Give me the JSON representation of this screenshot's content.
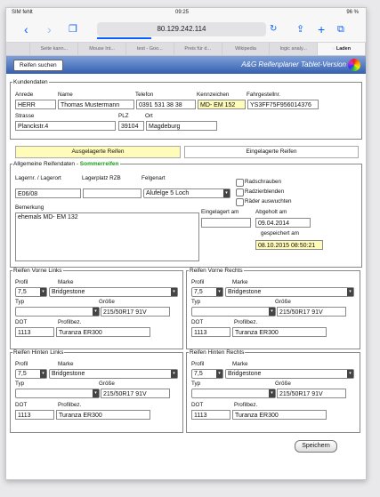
{
  "status": {
    "carrier": "SIM fehlt",
    "time": "09:25",
    "battery": "96 %"
  },
  "browser": {
    "url": "80.129.242.114",
    "load_fraction": 0.32
  },
  "tabs": [
    "",
    "Seite kann...",
    "Mouse Int...",
    "test - Goo...",
    "Preis für d...",
    "Wikipedia",
    "logic analy...",
    "Laden"
  ],
  "app": {
    "search_button": "Reifen suchen",
    "title": "A&G Reifenplaner Tablet-Version"
  },
  "kunde": {
    "legend": "Kundendaten",
    "labels": {
      "anrede": "Anrede",
      "name": "Name",
      "telefon": "Telefon",
      "kennzeichen": "Kennzeichen",
      "fahrgestell": "Fahrgestellnr.",
      "strasse": "Strasse",
      "plz": "PLZ",
      "ort": "Ort"
    },
    "anrede": "HERR",
    "name": "Thomas Mustermann",
    "telefon": "0391 531 38 38",
    "kennzeichen": "MD- EM 152",
    "fahrgestell": "YS3FF75F956014376",
    "strasse": "Planckstr.4",
    "plz": "39104",
    "ort": "Magdeburg"
  },
  "sections": {
    "ausgelagert": "Ausgelagerte Reifen",
    "eingelagert": "Eingelagerte Reifen"
  },
  "allgemein": {
    "legend_prefix": "Allgemeine Reifendaten - ",
    "legend_season": "Sommerreifen",
    "labels": {
      "lagerort": "Lagernr. / Lagerort",
      "lagerplatz": "Lagerplatz RZB",
      "felgenart": "Felgenart",
      "bemerkung": "Bemerkung",
      "eingelagert": "Eingelagert am",
      "abgeholt": "Abgeholt am",
      "gespeichert": "gespeichert am"
    },
    "lagerort": "E06/08",
    "lagerplatz": "",
    "felgenart": "Alufelge 5 Loch",
    "checkboxes": [
      "Radschrauben",
      "Radzierblenden",
      "Räder auswuchten"
    ],
    "bemerkung": "ehemals MD- EM 132",
    "eingelagert": "",
    "abgeholt": "09.04.2014",
    "gespeichert": "08.10.2015 08:50:21"
  },
  "labels": {
    "profil": "Profil",
    "marke": "Marke",
    "typ": "Typ",
    "groesse": "Größe",
    "dot": "DOT",
    "profilbez": "Profilbez."
  },
  "tires": [
    {
      "legend": "Reifen Vorne Links",
      "profil": "7,5",
      "marke": "Bridgestone",
      "typ": "",
      "groesse": "215/50R17 91V",
      "dot": "1113",
      "profilbez": "Turanza ER300"
    },
    {
      "legend": "Reifen Vorne Rechts",
      "profil": "7,5",
      "marke": "Bridgestone",
      "typ": "",
      "groesse": "215/50R17 91V",
      "dot": "1113",
      "profilbez": "Turanza ER300"
    },
    {
      "legend": "Reifen Hinten Links",
      "profil": "7,5",
      "marke": "Bridgestone",
      "typ": "",
      "groesse": "215/50R17 91V",
      "dot": "1113",
      "profilbez": "Turanza ER300"
    },
    {
      "legend": "Reifen Hinten Rechts",
      "profil": "7,5",
      "marke": "Bridgestone",
      "typ": "",
      "groesse": "215/50R17 91V",
      "dot": "1113",
      "profilbez": "Turanza ER300"
    }
  ],
  "save_button": "Speichern",
  "colors": {
    "accent": "#0a60ff",
    "highlight": "#fffbb8",
    "appbar": "#3560b0",
    "season": "#1a9a1a"
  }
}
